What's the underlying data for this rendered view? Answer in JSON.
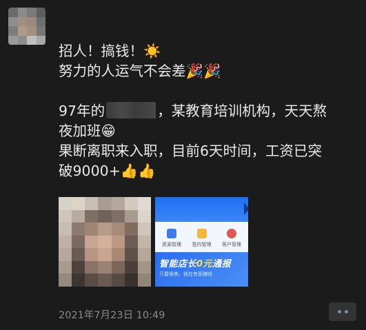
{
  "post": {
    "lines": [
      "招人！搞钱！☀️",
      "努力的人运气不会差🎉🎉",
      "97年的",
      "，某教育培训机构，天天熬",
      "夜加班😁",
      "果断离职来入职，目前6天时间，工资已突",
      "破9000+👍👍"
    ],
    "timestamp": "2021年7月23日 10:49"
  },
  "app_screenshot": {
    "menu": [
      "资源管理",
      "签约管理",
      "客户管理"
    ],
    "banner_title_prefix": "智能店长",
    "banner_title_highlight": "0元",
    "banner_title_suffix": "通报",
    "banner_subtitle": "只要很美，就在有驱赚钱"
  },
  "colors": {
    "background": "#1b1b1b",
    "text": "#e9e9e9",
    "timestamp": "#8a8a8a",
    "app_blue": "#2a6df0"
  },
  "icons": {
    "more": "more-dots-icon"
  }
}
